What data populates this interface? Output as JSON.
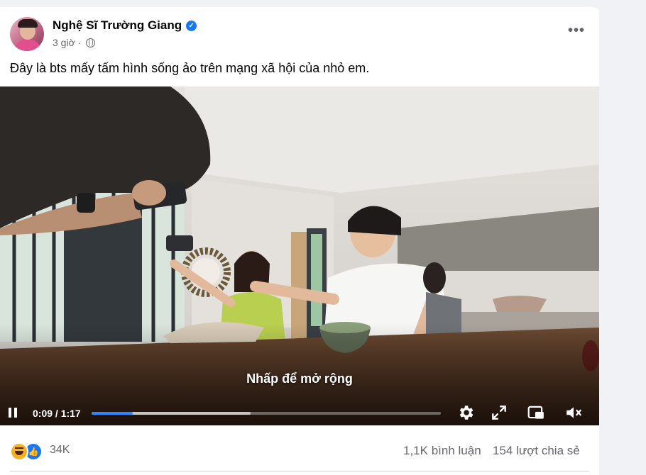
{
  "post": {
    "author": "Nghệ Sĩ Trường Giang",
    "verified_badge": "verified-icon",
    "time": "3 giờ ·",
    "privacy_icon": "globe-icon",
    "more_label": "•••",
    "caption": "Đây là bts mấy tấm hình sống ảo trên mạng xã hội của nhỏ em."
  },
  "video": {
    "overlay_hint": "Nhấp để mở rộng",
    "time_display": "0:09 / 1:17",
    "progress_fraction": 0.117,
    "state": "playing",
    "icons": [
      "pause-icon",
      "settings-icon",
      "fullscreen-icon",
      "picture-in-picture-icon",
      "mute-icon"
    ]
  },
  "footer": {
    "reaction_icons": [
      "haha-icon",
      "like-icon"
    ],
    "reaction_count": "34K",
    "comments": "1,1K bình luận",
    "shares": "154 lượt chia sẻ"
  },
  "colors": {
    "accent": "#2d88ff",
    "verified": "#1877f2",
    "secondary_text": "#65676b",
    "page_background": "#f0f2f5"
  }
}
